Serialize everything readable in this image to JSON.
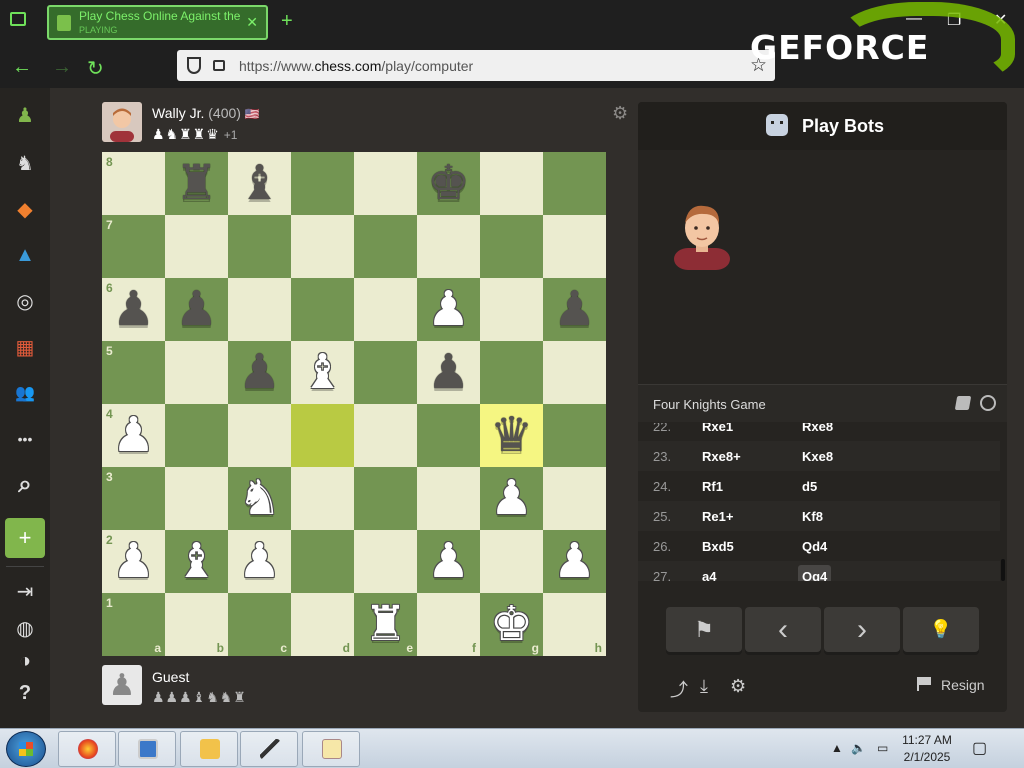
{
  "browser": {
    "tab_title": "Play Chess Online Against the",
    "tab_subtitle": "PLAYING",
    "url_prefix": "https://www.",
    "url_domain": "chess.com",
    "url_path": "/play/computer",
    "overlay_brand": "GEFORCE",
    "new_tab_symbol": "+",
    "close_tab_symbol": "✕",
    "back_symbol": "←",
    "forward_symbol": "→",
    "reload_symbol": "↻",
    "bookmark_symbol": "☆",
    "window_controls": {
      "minimize": "—",
      "maximize": "❐",
      "close": "✕"
    },
    "accent_color": "#6fe05a"
  },
  "sidebar": {
    "items": [
      {
        "name": "play",
        "glyph": "♟"
      },
      {
        "name": "puzzles",
        "glyph": "♞"
      },
      {
        "name": "learn",
        "glyph": "◆"
      },
      {
        "name": "lessons",
        "glyph": "▲"
      },
      {
        "name": "watch",
        "glyph": "◎"
      },
      {
        "name": "news",
        "glyph": "▦"
      },
      {
        "name": "social",
        "glyph": "👥"
      },
      {
        "name": "more",
        "glyph": "•••"
      },
      {
        "name": "search",
        "glyph": "⌕"
      },
      {
        "name": "signup",
        "glyph": "+"
      },
      {
        "name": "login",
        "glyph": "⇥"
      },
      {
        "name": "language",
        "glyph": "◍"
      },
      {
        "name": "theme",
        "glyph": "◑"
      },
      {
        "name": "help",
        "glyph": "?"
      }
    ]
  },
  "opponent": {
    "name": "Wally Jr.",
    "rating": "(400)",
    "flag": "🇺🇸",
    "captured": "♟♞♜♜♛",
    "advantage": "+1"
  },
  "player": {
    "name": "Guest",
    "captured": "♟♟♟♝♞♞♜"
  },
  "board": {
    "files": [
      "a",
      "b",
      "c",
      "d",
      "e",
      "f",
      "g",
      "h"
    ],
    "ranks": [
      "8",
      "7",
      "6",
      "5",
      "4",
      "3",
      "2",
      "1"
    ],
    "pieces": [
      {
        "sq": "b8",
        "p": "♜",
        "c": "b"
      },
      {
        "sq": "c8",
        "p": "♝",
        "c": "b"
      },
      {
        "sq": "f8",
        "p": "♚",
        "c": "b"
      },
      {
        "sq": "a6",
        "p": "♟",
        "c": "b"
      },
      {
        "sq": "b6",
        "p": "♟",
        "c": "b"
      },
      {
        "sq": "f6",
        "p": "♟",
        "c": "w"
      },
      {
        "sq": "h6",
        "p": "♟",
        "c": "b"
      },
      {
        "sq": "c5",
        "p": "♟",
        "c": "b"
      },
      {
        "sq": "d5",
        "p": "♝",
        "c": "w"
      },
      {
        "sq": "f5",
        "p": "♟",
        "c": "b"
      },
      {
        "sq": "a4",
        "p": "♟",
        "c": "w"
      },
      {
        "sq": "g4",
        "p": "♛",
        "c": "b"
      },
      {
        "sq": "c3",
        "p": "♞",
        "c": "w"
      },
      {
        "sq": "g3",
        "p": "♟",
        "c": "w"
      },
      {
        "sq": "a2",
        "p": "♟",
        "c": "w"
      },
      {
        "sq": "b2",
        "p": "♝",
        "c": "w"
      },
      {
        "sq": "c2",
        "p": "♟",
        "c": "w"
      },
      {
        "sq": "f2",
        "p": "♟",
        "c": "w"
      },
      {
        "sq": "h2",
        "p": "♟",
        "c": "w"
      },
      {
        "sq": "e1",
        "p": "♜",
        "c": "w"
      },
      {
        "sq": "g1",
        "p": "♚",
        "c": "w"
      }
    ],
    "highlights": [
      "d4",
      "g4"
    ],
    "light_color": "#ebecd0",
    "dark_color": "#739552"
  },
  "panel": {
    "title": "Play Bots",
    "opening": "Four Knights Game",
    "moves": [
      {
        "num": "22.",
        "white": "Rxe1",
        "black": "Rxe8"
      },
      {
        "num": "23.",
        "white": "Rxe8+",
        "black": "Kxe8"
      },
      {
        "num": "24.",
        "white": "Rf1",
        "black": "d5"
      },
      {
        "num": "25.",
        "white": "Re1+",
        "black": "Kf8"
      },
      {
        "num": "26.",
        "white": "Bxd5",
        "black": "Qd4"
      },
      {
        "num": "27.",
        "white": "a4",
        "black": "Qg4"
      }
    ],
    "controls": {
      "flag": "⚑",
      "prev": "‹",
      "next": "›",
      "hint": "💡"
    },
    "share_icon": "⤴",
    "download_icon": "⤓",
    "settings_icon": "⚙",
    "resign_label": "Resign"
  },
  "taskbar": {
    "time": "11:27 AM",
    "date": "2/1/2025"
  }
}
